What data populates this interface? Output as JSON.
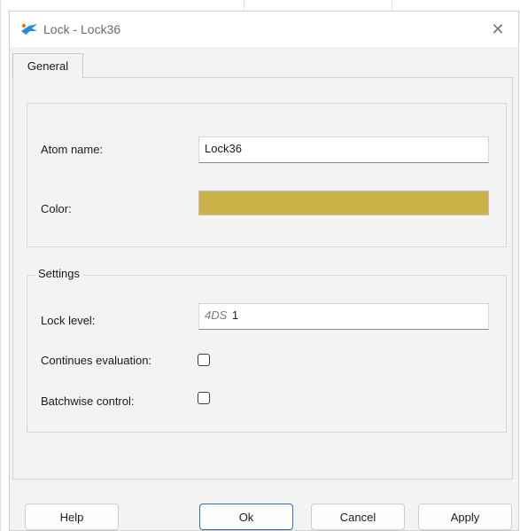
{
  "window": {
    "title": "Lock - Lock36",
    "app_icon": "app-bird-icon",
    "close_icon": "close-icon",
    "close_glyph": "✕"
  },
  "tabs": [
    {
      "label": "General",
      "active": true
    }
  ],
  "atom": {
    "name_label": "Atom name:",
    "name_value": "Lock36",
    "color_label": "Color:",
    "color_value": "#cdb149"
  },
  "settings": {
    "legend": "Settings",
    "lock_level_label": "Lock level:",
    "lock_level_prefix": "4DS",
    "lock_level_value": "1",
    "continues_evaluation_label": "Continues evaluation:",
    "continues_evaluation_checked": false,
    "batchwise_control_label": "Batchwise control:",
    "batchwise_control_checked": false
  },
  "buttons": {
    "help": "Help",
    "ok": "Ok",
    "cancel": "Cancel",
    "apply": "Apply"
  },
  "colors": {
    "dialog_bg": "#f3f3f3",
    "accent": "#2f6fb2",
    "icon_blue": "#1e90d6",
    "icon_orange": "#f07a1a"
  }
}
